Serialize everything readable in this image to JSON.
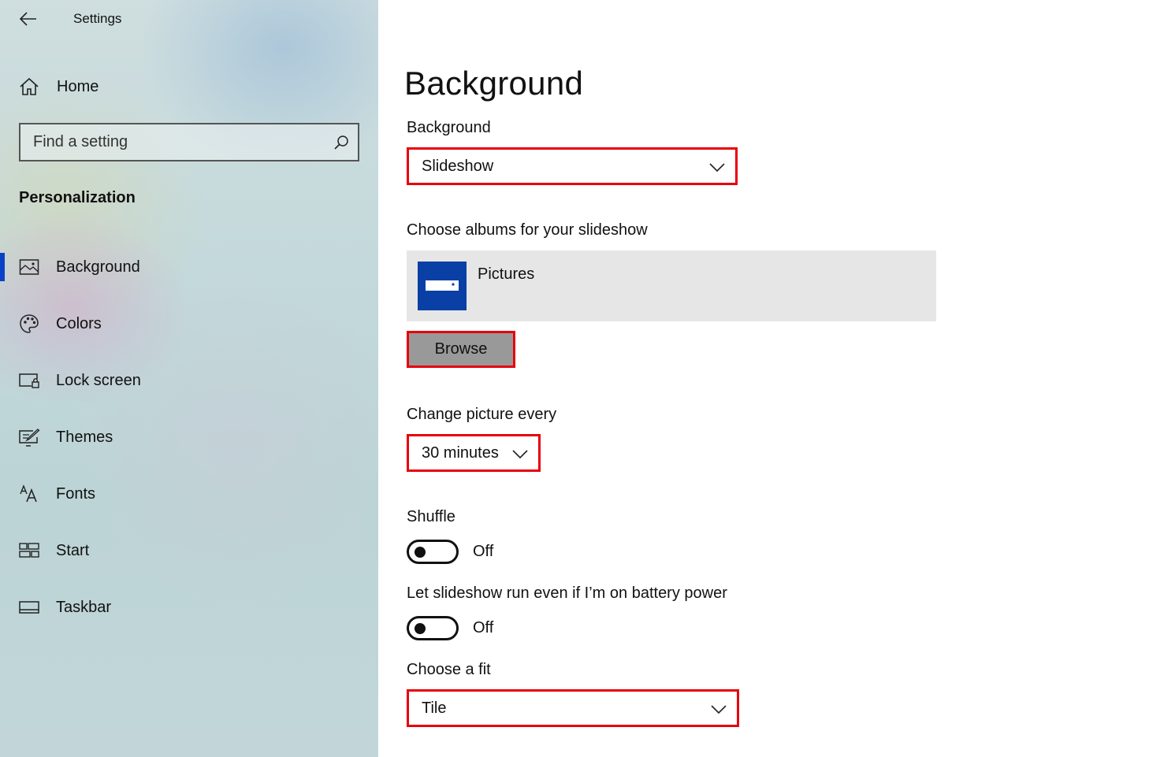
{
  "window": {
    "title": "Settings"
  },
  "sidebar": {
    "home_label": "Home",
    "search_placeholder": "Find a setting",
    "section_title": "Personalization",
    "items": [
      {
        "label": "Background",
        "icon": "picture-icon",
        "active": true
      },
      {
        "label": "Colors",
        "icon": "palette-icon"
      },
      {
        "label": "Lock screen",
        "icon": "lock-screen-icon"
      },
      {
        "label": "Themes",
        "icon": "themes-icon"
      },
      {
        "label": "Fonts",
        "icon": "fonts-icon"
      },
      {
        "label": "Start",
        "icon": "start-icon"
      },
      {
        "label": "Taskbar",
        "icon": "taskbar-icon"
      }
    ]
  },
  "main": {
    "title": "Background",
    "background": {
      "label": "Background",
      "value": "Slideshow"
    },
    "albums": {
      "label": "Choose albums for your slideshow",
      "album_name": "Pictures",
      "browse_label": "Browse"
    },
    "interval": {
      "label": "Change picture every",
      "value": "30 minutes"
    },
    "shuffle": {
      "label": "Shuffle",
      "state": "Off"
    },
    "battery": {
      "label": "Let slideshow run even if I’m on battery power",
      "state": "Off"
    },
    "fit": {
      "label": "Choose a fit",
      "value": "Tile"
    }
  },
  "colors": {
    "accent": "#0a3fc7",
    "highlight": "#e8000b",
    "album_thumb": "#0a3fa6"
  }
}
